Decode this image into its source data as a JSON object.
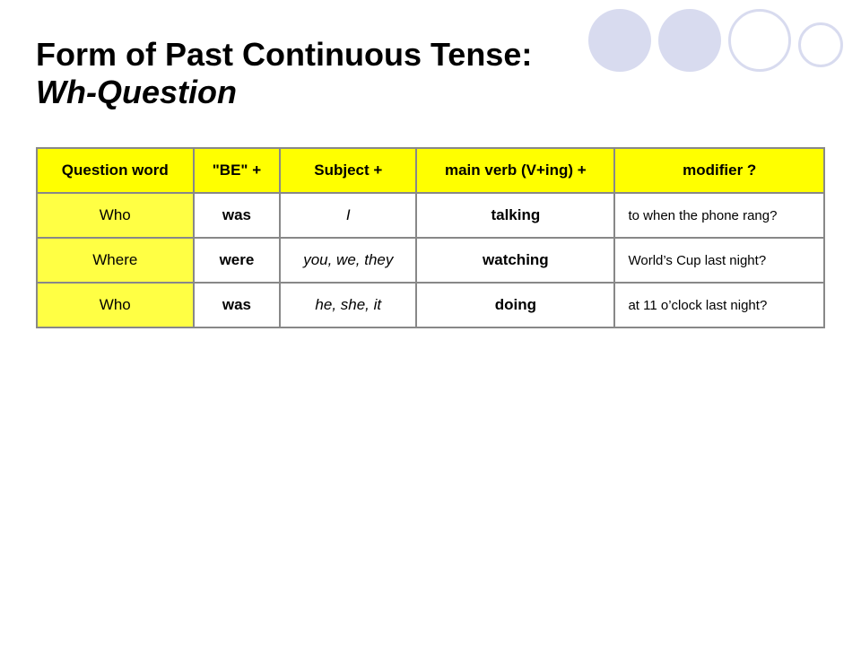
{
  "title": {
    "line1": "Form of Past Continuous Tense:",
    "line2": "Wh-Question"
  },
  "table": {
    "headers": [
      "Question word",
      "\"BE\" +",
      "Subject +",
      "main verb (V+ing) +",
      "modifier ?"
    ],
    "rows": [
      {
        "question_word": "Who",
        "be": "was",
        "subject": "I",
        "main_verb": "talking",
        "modifier": "to when the phone rang?"
      },
      {
        "question_word": "Where",
        "be": "were",
        "subject": "you, we, they",
        "main_verb": "watching",
        "modifier": "World’s Cup last night?"
      },
      {
        "question_word": "Who",
        "be": "was",
        "subject": "he, she, it",
        "main_verb": "doing",
        "modifier": "at 11 o’clock last night?"
      }
    ]
  },
  "decorative": {
    "circles": [
      "filled",
      "filled",
      "outline",
      "small-outline"
    ]
  }
}
